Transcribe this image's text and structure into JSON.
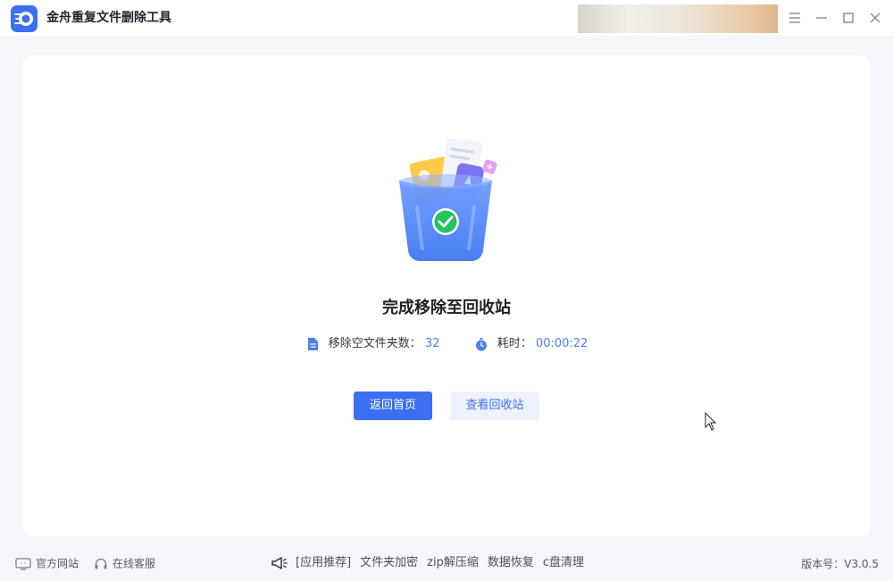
{
  "app": {
    "title": "金舟重复文件删除工具",
    "accent_color": "#3d6ff2"
  },
  "window_controls": {
    "menu_icon": "hamburger-menu-icon",
    "minimize_icon": "minimize-icon",
    "maximize_icon": "maximize-icon",
    "close_icon": "close-icon"
  },
  "result": {
    "title": "完成移除至回收站",
    "stats": [
      {
        "icon": "document-icon",
        "label": "移除空文件夹数：",
        "value": "32"
      },
      {
        "icon": "stopwatch-icon",
        "label": "耗时：",
        "value": "00:00:22"
      }
    ],
    "stat_value_color": "#4f7ef0"
  },
  "actions": {
    "primary_label": "返回首页",
    "secondary_label": "查看回收站"
  },
  "footer": {
    "website_label": "官方网站",
    "support_label": "在线客服",
    "recommend_label": "[应用推荐]",
    "recommend_links": [
      "文件夹加密",
      "zip解压缩",
      "数据恢复",
      "c盘清理"
    ],
    "version_label": "版本号：V3.0.5"
  }
}
